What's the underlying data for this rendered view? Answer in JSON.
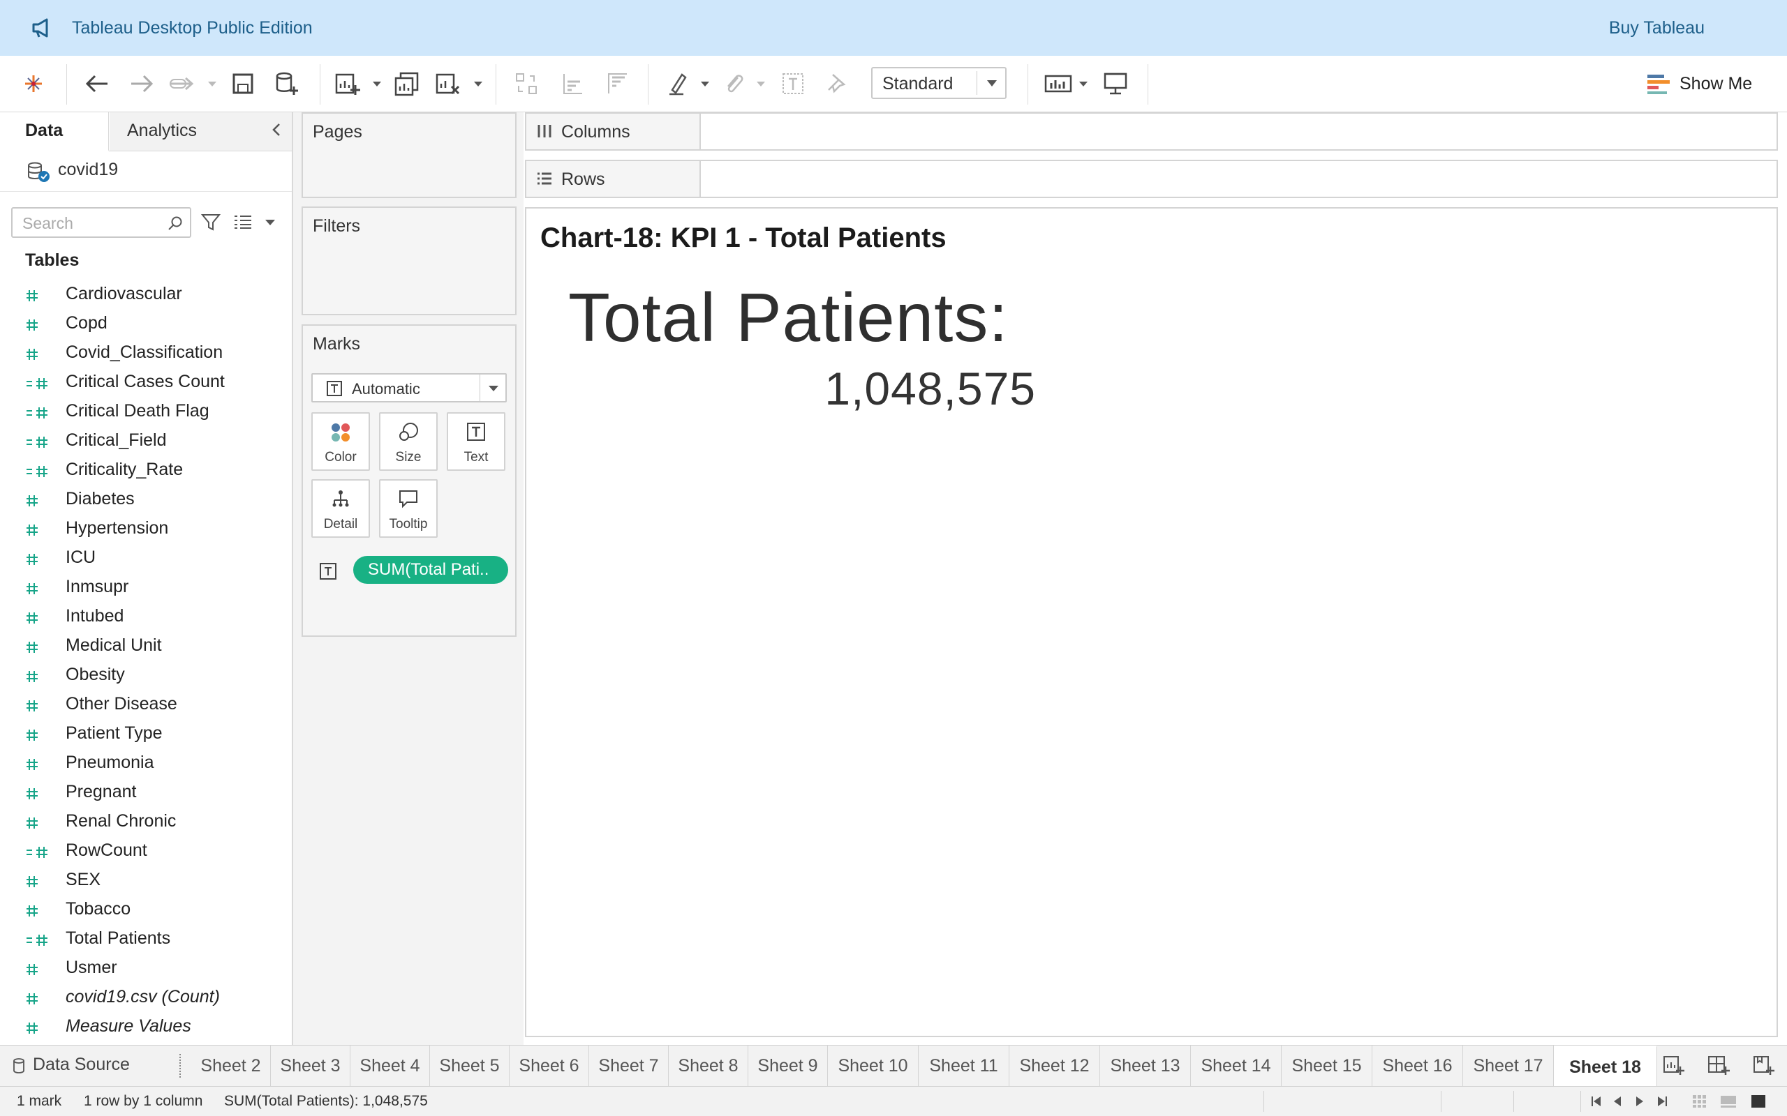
{
  "banner": {
    "title": "Tableau Desktop Public Edition",
    "buy_label": "Buy Tableau"
  },
  "toolbar": {
    "view_size": "Standard",
    "show_me_label": "Show Me"
  },
  "data_pane": {
    "tab_data": "Data",
    "tab_analytics": "Analytics",
    "datasource": "covid19",
    "search_placeholder": "Search",
    "tables_header": "Tables",
    "fields": [
      {
        "name": "Cardiovascular",
        "calc": false,
        "italic": false
      },
      {
        "name": "Copd",
        "calc": false,
        "italic": false
      },
      {
        "name": "Covid_Classification",
        "calc": false,
        "italic": false
      },
      {
        "name": "Critical Cases Count",
        "calc": true,
        "italic": false
      },
      {
        "name": "Critical Death Flag",
        "calc": true,
        "italic": false
      },
      {
        "name": "Critical_Field",
        "calc": true,
        "italic": false
      },
      {
        "name": "Criticality_Rate",
        "calc": true,
        "italic": false
      },
      {
        "name": "Diabetes",
        "calc": false,
        "italic": false
      },
      {
        "name": "Hypertension",
        "calc": false,
        "italic": false
      },
      {
        "name": "ICU",
        "calc": false,
        "italic": false
      },
      {
        "name": "Inmsupr",
        "calc": false,
        "italic": false
      },
      {
        "name": "Intubed",
        "calc": false,
        "italic": false
      },
      {
        "name": "Medical Unit",
        "calc": false,
        "italic": false
      },
      {
        "name": "Obesity",
        "calc": false,
        "italic": false
      },
      {
        "name": "Other Disease",
        "calc": false,
        "italic": false
      },
      {
        "name": "Patient Type",
        "calc": false,
        "italic": false
      },
      {
        "name": "Pneumonia",
        "calc": false,
        "italic": false
      },
      {
        "name": "Pregnant",
        "calc": false,
        "italic": false
      },
      {
        "name": "Renal Chronic",
        "calc": false,
        "italic": false
      },
      {
        "name": "RowCount",
        "calc": true,
        "italic": false
      },
      {
        "name": "SEX",
        "calc": false,
        "italic": false
      },
      {
        "name": "Tobacco",
        "calc": false,
        "italic": false
      },
      {
        "name": "Total Patients",
        "calc": true,
        "italic": false
      },
      {
        "name": "Usmer",
        "calc": false,
        "italic": false
      },
      {
        "name": "covid19.csv (Count)",
        "calc": false,
        "italic": true
      },
      {
        "name": "Measure Values",
        "calc": false,
        "italic": true
      }
    ]
  },
  "shelves": {
    "pages": "Pages",
    "filters": "Filters",
    "marks": "Marks",
    "mark_type": "Automatic",
    "mark_buttons": {
      "color": "Color",
      "size": "Size",
      "text": "Text",
      "detail": "Detail",
      "tooltip": "Tooltip"
    },
    "text_pill": "SUM(Total Pati..",
    "columns": "Columns",
    "rows": "Rows"
  },
  "view": {
    "sheet_title": "Chart-18: KPI 1 - Total Patients",
    "kpi_label": "Total Patients:",
    "kpi_value": "1,048,575"
  },
  "sheet_tabs": {
    "data_source": "Data Source",
    "tabs": [
      "Sheet 2",
      "Sheet 3",
      "Sheet 4",
      "Sheet 5",
      "Sheet 6",
      "Sheet 7",
      "Sheet 8",
      "Sheet 9",
      "Sheet 10",
      "Sheet 11",
      "Sheet 12",
      "Sheet 13",
      "Sheet 14",
      "Sheet 15",
      "Sheet 16",
      "Sheet 17",
      "Sheet 18"
    ],
    "active": "Sheet 18"
  },
  "status_bar": {
    "marks": "1 mark",
    "dims": "1 row by 1 column",
    "sum": "SUM(Total Patients): 1,048,575"
  },
  "colors": {
    "banner_bg": "#cfe7fb",
    "pill_green": "#18b184",
    "measure_green": "#17a589"
  }
}
